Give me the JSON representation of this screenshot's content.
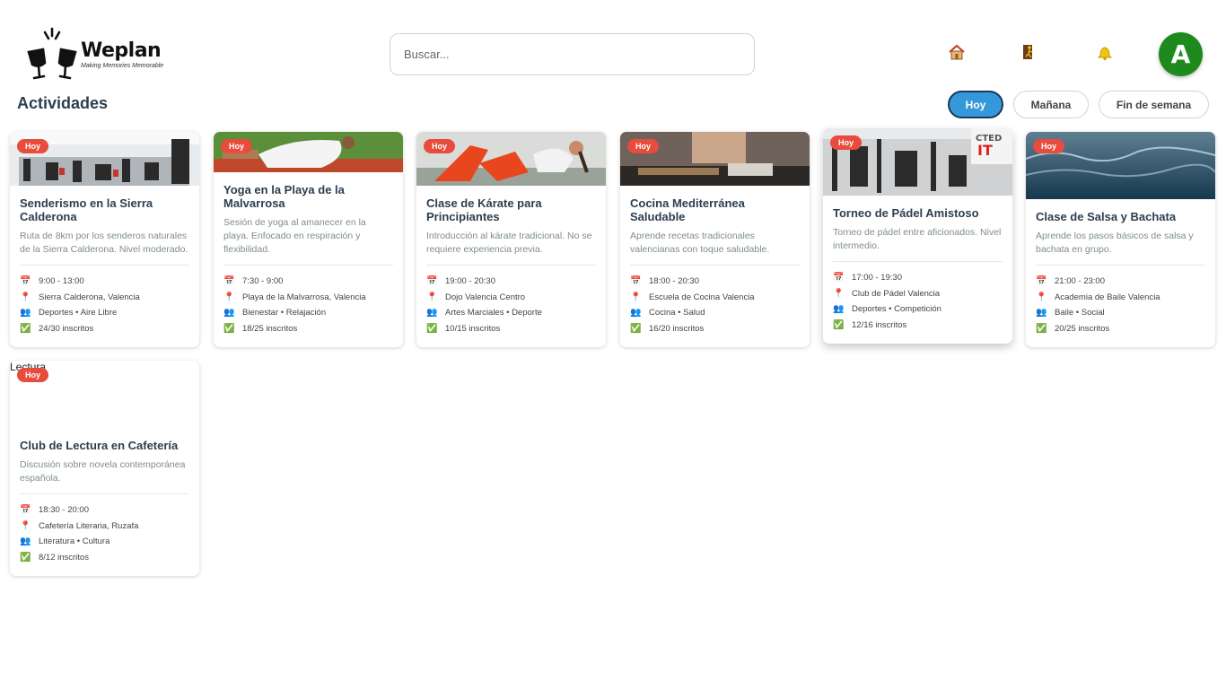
{
  "header": {
    "logo_name": "Weplan",
    "logo_tagline": "Making Memories Memorable",
    "search_placeholder": "Buscar...",
    "avatar_letter": "A",
    "icons": [
      "home-icon",
      "door-exit-icon",
      "bell-icon"
    ]
  },
  "page_title": "Actividades",
  "filters": [
    "Hoy",
    "Mañana",
    "Fin de semana"
  ],
  "active_filter": "Hoy",
  "colors": {
    "accent": "#3498db",
    "badge": "#e74c3c",
    "avatar": "#1e8a1e"
  },
  "cards": [
    {
      "badge": "Hoy",
      "title": "Senderismo en la Sierra Calderona",
      "description": "Ruta de 8km por los senderos naturales de la Sierra Calderona. Nivel moderado.",
      "time": "9:00 - 13:00",
      "location": "Sierra Calderona, Valencia",
      "tags": "Deportes • Aire Libre",
      "enrolled": "24/30 inscritos"
    },
    {
      "badge": "Hoy",
      "title": "Yoga en la Playa de la Malvarrosa",
      "description": "Sesión de yoga al amanecer en la playa. Enfocado en respiración y flexibilidad.",
      "time": "7:30 - 9:00",
      "location": "Playa de la Malvarrosa, Valencia",
      "tags": "Bienestar • Relajación",
      "enrolled": "18/25 inscritos"
    },
    {
      "badge": "Hoy",
      "title": "Clase de Kárate para Principiantes",
      "description": "Introducción al kárate tradicional. No se requiere experiencia previa.",
      "time": "19:00 - 20:30",
      "location": "Dojo Valencia Centro",
      "tags": "Artes Marciales • Deporte",
      "enrolled": "10/15 inscritos"
    },
    {
      "badge": "Hoy",
      "title": "Cocina Mediterránea Saludable",
      "description": "Aprende recetas tradicionales valencianas con toque saludable.",
      "time": "18:00 - 20:30",
      "location": "Escuela de Cocina Valencia",
      "tags": "Cocina • Salud",
      "enrolled": "16/20 inscritos"
    },
    {
      "badge": "Hoy",
      "title": "Torneo de Pádel Amistoso",
      "description": "Torneo de pádel entre aficionados. Nivel intermedio.",
      "time": "17:00 - 19:30",
      "location": "Club de Pádel Valencia",
      "tags": "Deportes • Competición",
      "enrolled": "12/16 inscritos"
    },
    {
      "badge": "Hoy",
      "title": "Clase de Salsa y Bachata",
      "description": "Aprende los pasos básicos de salsa y bachata en grupo.",
      "time": "21:00 - 23:00",
      "location": "Academia de Baile Valencia",
      "tags": "Baile • Social",
      "enrolled": "20/25 inscritos"
    },
    {
      "badge": "Hoy",
      "image_alt": "Lectura",
      "title": "Club de Lectura en Cafetería",
      "description": "Discusión sobre novela contemporánea española.",
      "time": "18:30 - 20:00",
      "location": "Cafetería Literaria, Ruzafa",
      "tags": "Literatura • Cultura",
      "enrolled": "8/12 inscritos"
    }
  ]
}
